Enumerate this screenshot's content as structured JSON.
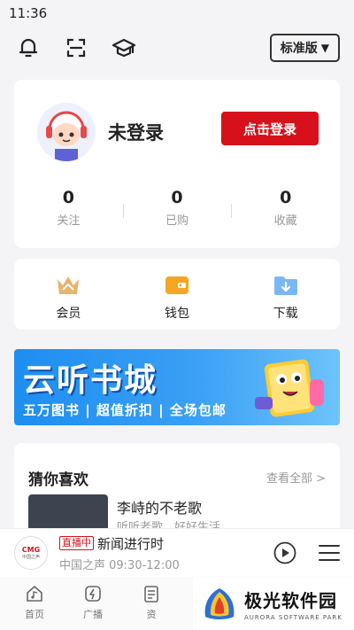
{
  "status_bar": {
    "time": "11:36"
  },
  "top_bar": {
    "edition_label": "标准版",
    "icons": [
      "bell-icon",
      "scan-icon",
      "cap-icon"
    ]
  },
  "user": {
    "name": "未登录",
    "login_label": "点击登录",
    "stats": [
      {
        "value": "0",
        "label": "关注"
      },
      {
        "value": "0",
        "label": "已购"
      },
      {
        "value": "0",
        "label": "收藏"
      }
    ]
  },
  "services": [
    {
      "label": "会员",
      "icon": "crown-icon"
    },
    {
      "label": "钱包",
      "icon": "wallet-icon"
    },
    {
      "label": "下载",
      "icon": "download-folder-icon"
    }
  ],
  "banner": {
    "title": "云听书城",
    "subtitle": "五万图书 | 超值折扣 | 全场包邮"
  },
  "recommend": {
    "title": "猜你喜欢",
    "more_label": "查看全部",
    "items": [
      {
        "title": "李峙的不老歌",
        "subtitle": "听听老歌，好好生活"
      }
    ]
  },
  "player": {
    "logo_text": "CMG",
    "logo_sub": "中国之声",
    "live_badge": "直播中",
    "title": "新闻进行时",
    "subtitle": "中国之声 09:30-12:00"
  },
  "tabs": [
    {
      "label": "首页",
      "icon": "home-music-icon"
    },
    {
      "label": "广播",
      "icon": "radio-icon"
    },
    {
      "label": "资",
      "icon": "document-icon"
    }
  ],
  "watermark": {
    "name": "极光软件园",
    "name_en": "AURORA SOFTWARE PARK"
  },
  "colors": {
    "accent": "#d7111b",
    "banner_blue": "#1d8ef0",
    "background": "#f4f4f6"
  }
}
